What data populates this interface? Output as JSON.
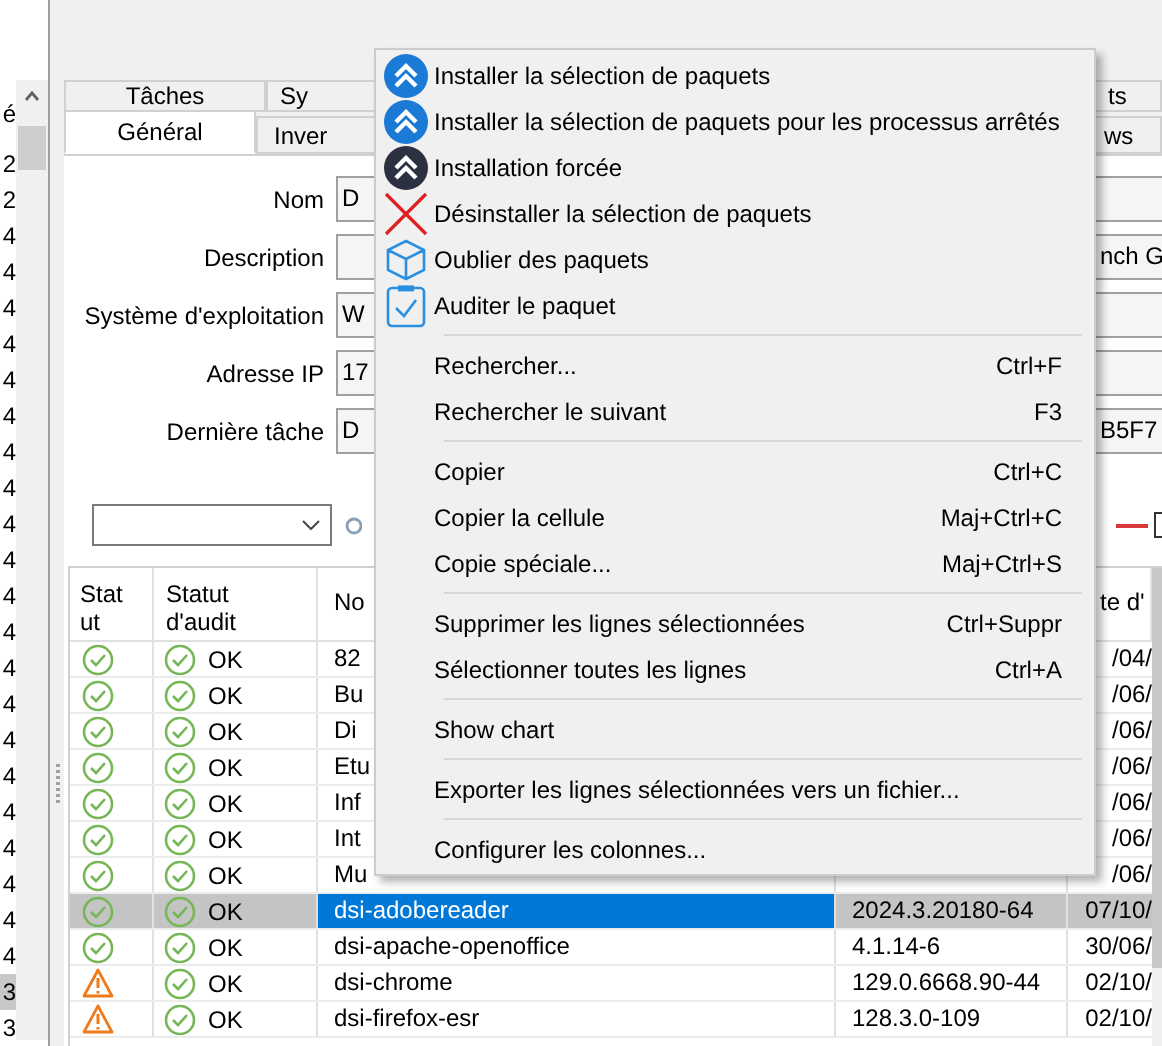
{
  "left_list": {
    "header": "é",
    "items": [
      {
        "text": "2",
        "selected": false
      },
      {
        "text": "2",
        "selected": false
      },
      {
        "text": "4",
        "selected": false
      },
      {
        "text": "4",
        "selected": false
      },
      {
        "text": "4",
        "selected": false
      },
      {
        "text": "4",
        "selected": false
      },
      {
        "text": "4",
        "selected": false
      },
      {
        "text": "4",
        "selected": false
      },
      {
        "text": "4",
        "selected": false
      },
      {
        "text": "4",
        "selected": false
      },
      {
        "text": "4",
        "selected": false
      },
      {
        "text": "4",
        "selected": false
      },
      {
        "text": "4",
        "selected": false
      },
      {
        "text": "4",
        "selected": false
      },
      {
        "text": "4",
        "selected": false
      },
      {
        "text": "4",
        "selected": false
      },
      {
        "text": "4",
        "selected": false
      },
      {
        "text": "4",
        "selected": false
      },
      {
        "text": "4",
        "selected": false
      },
      {
        "text": "4",
        "selected": false
      },
      {
        "text": "4",
        "selected": false
      },
      {
        "text": "4",
        "selected": false
      },
      {
        "text": "4",
        "selected": false
      },
      {
        "text": "3",
        "selected": true
      },
      {
        "text": "3",
        "selected": false
      }
    ]
  },
  "tabs_row_1": [
    {
      "label": "Tâches"
    },
    {
      "label": "Sy"
    },
    {
      "label": "ts"
    }
  ],
  "tabs_row_2": [
    {
      "label": "Général",
      "selected": true
    },
    {
      "label": "Inver",
      "selected": false
    },
    {
      "label": "ws",
      "selected": false
    }
  ],
  "form": [
    {
      "label": "Nom",
      "value": "D"
    },
    {
      "label": "Description",
      "value_right": "nch G"
    },
    {
      "label": "Système d'exploitation",
      "value": "W"
    },
    {
      "label": "Adresse IP",
      "value": "17"
    },
    {
      "label": "Dernière tâche",
      "value": "D",
      "value_right": "B5F7"
    }
  ],
  "filter_checkbox": {
    "checked": false
  },
  "table": {
    "columns": [
      "Statut",
      "Statut d'audit",
      "No",
      "te d'"
    ],
    "rows": [
      {
        "kind": "ok",
        "audit": "OK",
        "name": "82",
        "date": "/04/",
        "selected": false
      },
      {
        "kind": "ok",
        "audit": "OK",
        "name": "Bu",
        "date": "/06/",
        "selected": false
      },
      {
        "kind": "ok",
        "audit": "OK",
        "name": "Di",
        "date": "/06/",
        "selected": false
      },
      {
        "kind": "ok",
        "audit": "OK",
        "name": "Etu",
        "date": "/06/",
        "selected": false
      },
      {
        "kind": "ok",
        "audit": "OK",
        "name": "Inf",
        "date": "/06/",
        "selected": false
      },
      {
        "kind": "ok",
        "audit": "OK",
        "name": "Int",
        "date": "/06/",
        "selected": false
      },
      {
        "kind": "ok",
        "audit": "OK",
        "name": "Mu",
        "date": "/06/",
        "selected": false
      },
      {
        "kind": "ok",
        "audit": "OK",
        "name": "dsi-adobereader",
        "version": "2024.3.20180-64",
        "date": "07/10/",
        "selected": true
      },
      {
        "kind": "ok",
        "audit": "OK",
        "name": "dsi-apache-openoffice",
        "version": "4.1.14-6",
        "date": "30/06/",
        "selected": false
      },
      {
        "kind": "warning",
        "audit": "OK",
        "name": "dsi-chrome",
        "version": "129.0.6668.90-44",
        "date": "02/10/",
        "selected": false
      },
      {
        "kind": "warning",
        "audit": "OK",
        "name": "dsi-firefox-esr",
        "version": "128.3.0-109",
        "date": "02/10/",
        "selected": false
      }
    ]
  },
  "context_menu": {
    "groups": [
      [
        {
          "label": "Installer la sélection de paquets"
        },
        {
          "label": "Installer la sélection de paquets pour les processus arrêtés"
        },
        {
          "label": "Installation forcée"
        },
        {
          "label": "Désinstaller la sélection de paquets"
        },
        {
          "label": "Oublier des paquets"
        },
        {
          "label": "Auditer le paquet"
        }
      ],
      [
        {
          "label": "Rechercher...",
          "shortcut": "Ctrl+F"
        },
        {
          "label": "Rechercher le suivant",
          "shortcut": "F3"
        }
      ],
      [
        {
          "label": "Copier",
          "shortcut": "Ctrl+C"
        },
        {
          "label": "Copier la cellule",
          "shortcut": "Maj+Ctrl+C"
        },
        {
          "label": "Copie spéciale...",
          "shortcut": "Maj+Ctrl+S"
        }
      ],
      [
        {
          "label": "Supprimer les lignes sélectionnées",
          "shortcut": "Ctrl+Suppr"
        },
        {
          "label": "Sélectionner toutes les lignes",
          "shortcut": "Ctrl+A"
        }
      ],
      [
        {
          "label": "Show chart"
        }
      ],
      [
        {
          "label": "Exporter les lignes sélectionnées vers un fichier..."
        }
      ],
      [
        {
          "label": "Configurer les colonnes..."
        }
      ]
    ]
  }
}
